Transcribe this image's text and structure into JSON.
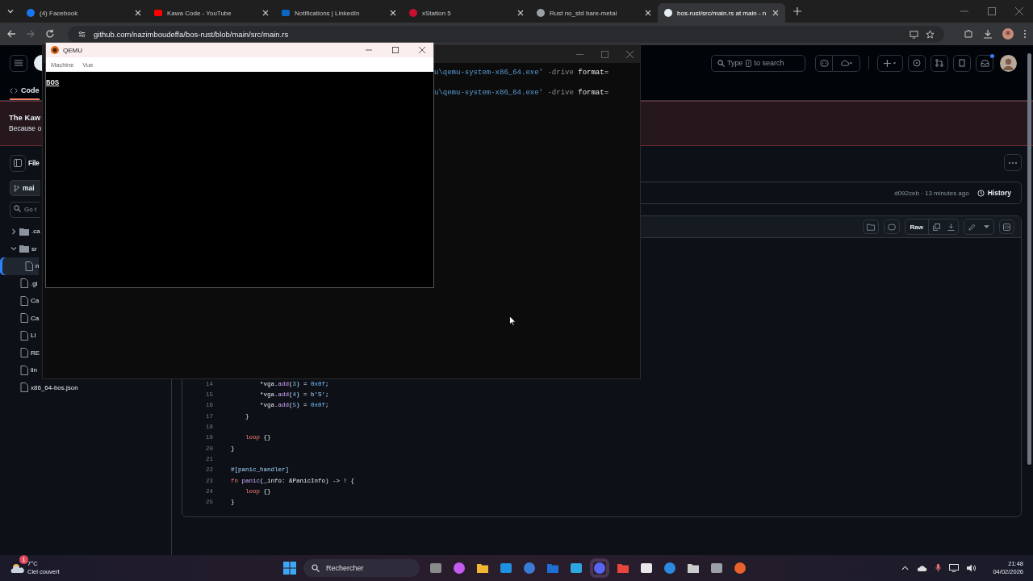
{
  "browser": {
    "tabs": [
      {
        "title": "(4) Facebook",
        "selected": false
      },
      {
        "title": "Kawa Code - YouTube",
        "selected": false
      },
      {
        "title": "Notifications | LinkedIn",
        "selected": false
      },
      {
        "title": "xStation 5",
        "selected": false
      },
      {
        "title": "Rust no_std bare-metal",
        "selected": false
      },
      {
        "title": "bos-rust/src/main.rs at main - n",
        "selected": true
      }
    ],
    "url": "github.com/nazimboudeffa/bos-rust/blob/main/src/main.rs"
  },
  "github": {
    "search": {
      "before": "Type",
      "key": "/",
      "after": "to search"
    },
    "code_tab": "Code",
    "banner": {
      "title": "The Kaw",
      "text": "Because o"
    },
    "files_title": "File",
    "branch": "mai",
    "file_search": {
      "placeholder": "Go t"
    },
    "tree": [
      {
        "name": ".ca",
        "kind": "folder",
        "expanded": false,
        "selected": false
      },
      {
        "name": "sr",
        "kind": "folder",
        "expanded": true,
        "selected": false,
        "children": [
          {
            "name": "n",
            "kind": "file",
            "selected": true
          }
        ]
      },
      {
        "name": ".gi",
        "kind": "file",
        "selected": false
      },
      {
        "name": "Ca",
        "kind": "file",
        "selected": false
      },
      {
        "name": "Ca",
        "kind": "file",
        "selected": false
      },
      {
        "name": "LI",
        "kind": "file",
        "selected": false
      },
      {
        "name": "RE",
        "kind": "file",
        "selected": false
      },
      {
        "name": "lin",
        "kind": "file",
        "selected": false
      },
      {
        "name": "x86_64-bos.json",
        "kind": "file",
        "selected": false
      }
    ],
    "commit": "d092ceb · 13 minutes ago",
    "history": "History",
    "raw": "Raw",
    "code": [
      {
        "number": "14",
        "tokens": [
          {
            "kind": "plain",
            "text": "        *vga."
          },
          {
            "kind": "fn",
            "text": "add"
          },
          {
            "kind": "plain",
            "text": "("
          },
          {
            "kind": "num",
            "text": "3"
          },
          {
            "kind": "plain",
            "text": ") = "
          },
          {
            "kind": "num",
            "text": "0x0f"
          },
          {
            "kind": "plain",
            "text": ";"
          }
        ]
      },
      {
        "number": "15",
        "tokens": [
          {
            "kind": "plain",
            "text": "        *vga."
          },
          {
            "kind": "fn",
            "text": "add"
          },
          {
            "kind": "plain",
            "text": "("
          },
          {
            "kind": "num",
            "text": "4"
          },
          {
            "kind": "plain",
            "text": ") = "
          },
          {
            "kind": "str",
            "text": "b'S'"
          },
          {
            "kind": "plain",
            "text": ";"
          }
        ]
      },
      {
        "number": "16",
        "tokens": [
          {
            "kind": "plain",
            "text": "        *vga."
          },
          {
            "kind": "fn",
            "text": "add"
          },
          {
            "kind": "plain",
            "text": "("
          },
          {
            "kind": "num",
            "text": "5"
          },
          {
            "kind": "plain",
            "text": ") = "
          },
          {
            "kind": "num",
            "text": "0x0f"
          },
          {
            "kind": "plain",
            "text": ";"
          }
        ]
      },
      {
        "number": "17",
        "tokens": [
          {
            "kind": "plain",
            "text": "    }"
          }
        ]
      },
      {
        "number": "18"
      },
      {
        "number": "19",
        "tokens": [
          {
            "kind": "kw",
            "text": "    loop"
          },
          {
            "kind": "plain",
            "text": " {}"
          }
        ]
      },
      {
        "number": "20",
        "tokens": [
          {
            "kind": "plain",
            "text": "}"
          }
        ]
      },
      {
        "number": "21"
      },
      {
        "number": "22",
        "tokens": [
          {
            "kind": "str",
            "text": "#[panic_handler]"
          }
        ]
      },
      {
        "number": "23",
        "tokens": [
          {
            "kind": "kw",
            "text": "fn"
          },
          {
            "kind": "fn",
            "text": " panic"
          },
          {
            "kind": "plain",
            "text": "(_info: &PanicInfo) -> ! {"
          }
        ]
      },
      {
        "number": "24",
        "tokens": [
          {
            "kind": "kw",
            "text": "    loop"
          },
          {
            "kind": "plain",
            "text": " {}"
          }
        ]
      },
      {
        "number": "25",
        "tokens": [
          {
            "kind": "plain",
            "text": "}"
          }
        ]
      }
    ]
  },
  "terminal": {
    "lines": [
      [
        {
          "kind": "path",
          "text": "u\\qemu-system-x86_64.exe'"
        },
        {
          "kind": "flag",
          "text": " -drive"
        },
        {
          "kind": "arg",
          "text": " format="
        }
      ],
      [
        {
          "kind": "path",
          "text": "u\\qemu-system-x86_64.exe'"
        },
        {
          "kind": "flag",
          "text": " -drive"
        },
        {
          "kind": "arg",
          "text": " format="
        }
      ]
    ]
  },
  "qemu": {
    "title": "QEMU",
    "menu": [
      "Machine",
      "Vue"
    ],
    "screen": "BOS"
  },
  "taskbar": {
    "temperature": "7°C",
    "weather": "Ciel couvert",
    "weather_badge": "1",
    "search": "Rechercher",
    "time": "21:48",
    "date": "04/02/2026"
  }
}
